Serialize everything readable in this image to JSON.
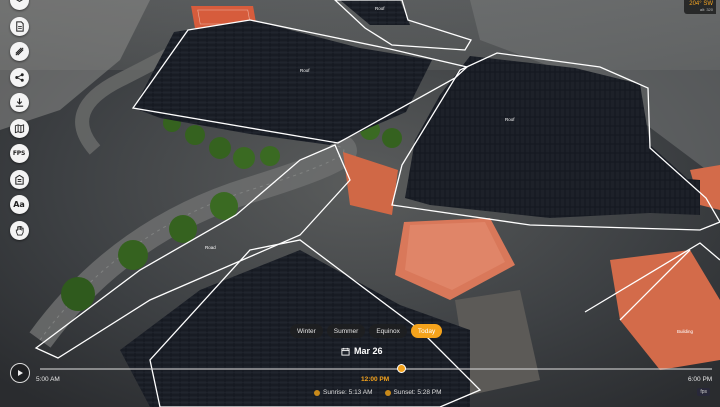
{
  "compass": {
    "heading": "204° SW",
    "sub": "alt: 320"
  },
  "toolbar": {
    "tools": [
      {
        "name": "layers-tool",
        "icon": "layers-icon"
      },
      {
        "name": "report-tool",
        "icon": "document-icon"
      },
      {
        "name": "measure-tool",
        "icon": "measure-icon"
      },
      {
        "name": "share-tool",
        "icon": "share-icon"
      },
      {
        "name": "download-tool",
        "icon": "download-icon"
      },
      {
        "name": "map-tool",
        "icon": "map-icon"
      },
      {
        "name": "fps-tool",
        "icon": "fps-icon",
        "label": "FPS"
      },
      {
        "name": "building-tool",
        "icon": "building-icon"
      },
      {
        "name": "text-tool",
        "icon": "text-icon",
        "label": "Aa"
      },
      {
        "name": "hand-tool",
        "icon": "hand-icon"
      }
    ]
  },
  "scene": {
    "labels": [
      "Roof",
      "Roof",
      "Roof",
      "Road",
      "Building"
    ]
  },
  "seasons": {
    "options": [
      "Winter",
      "Summer",
      "Equinox",
      "Today"
    ],
    "active": "Today"
  },
  "date": {
    "value": "Mar 26"
  },
  "timeline": {
    "start": "5:00 AM",
    "current": "12:00 PM",
    "end": "6:00 PM",
    "progress": 0.5385
  },
  "sun": {
    "sunrise": "Sunrise: 5:13 AM",
    "sunset": "Sunset: 5:28 PM"
  },
  "fps_badge": "fps",
  "colors": {
    "accent": "#f5a31c",
    "outline": "#ffffff",
    "panel": "#15181e"
  }
}
